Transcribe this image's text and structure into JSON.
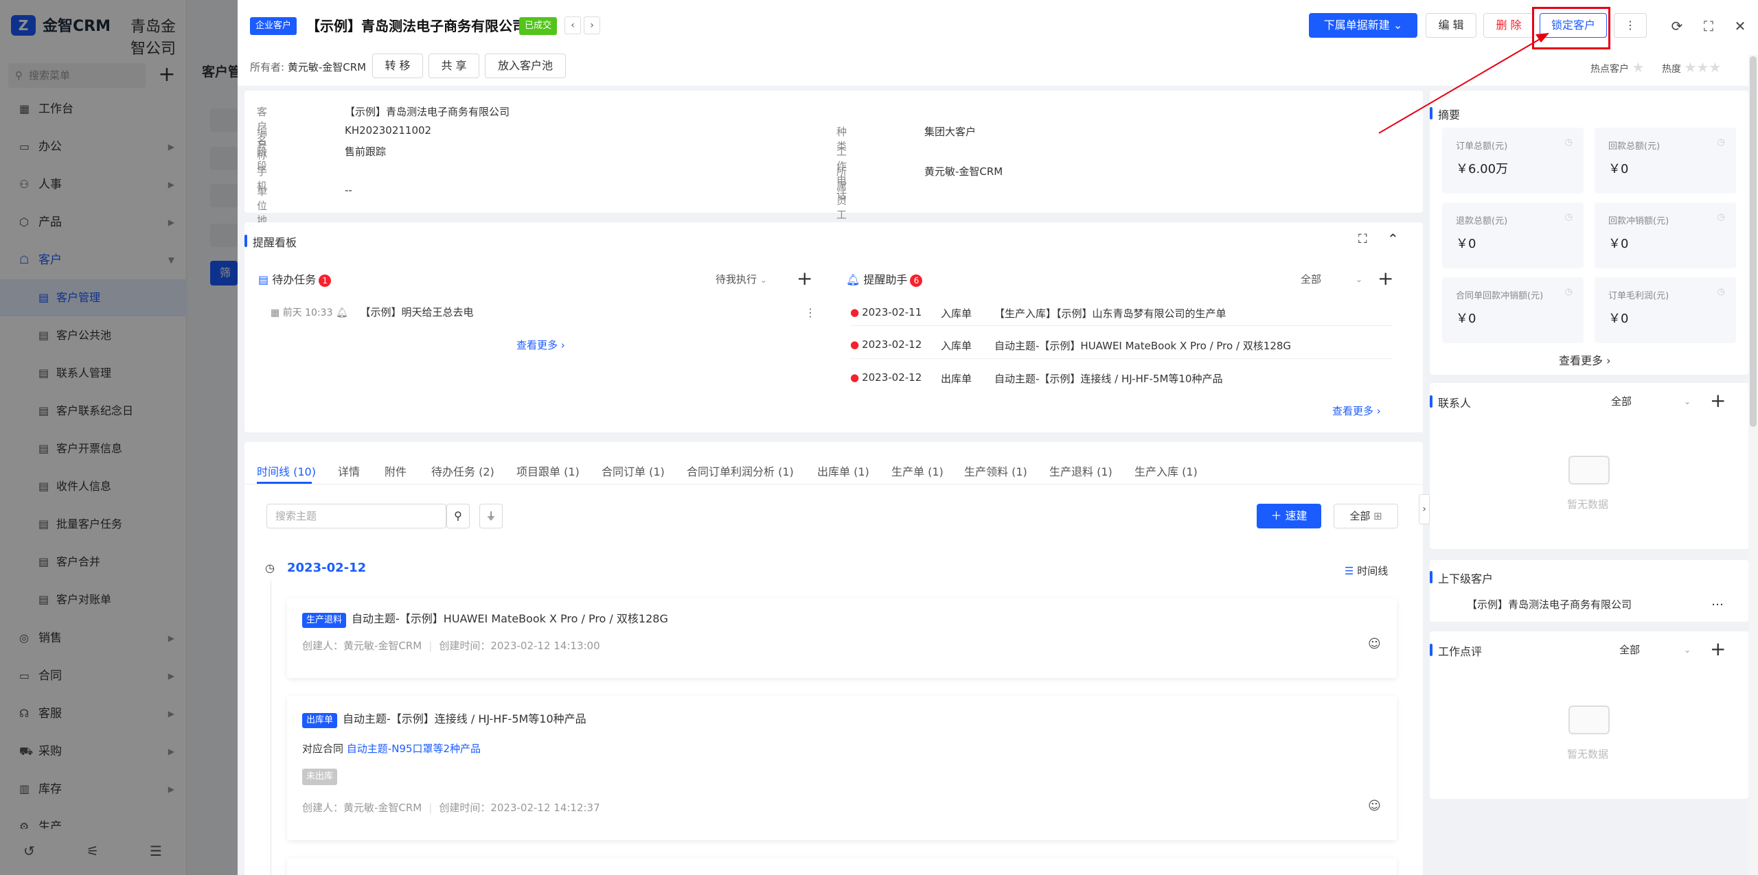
{
  "app": {
    "brand": "金智CRM",
    "company": "青岛金智公司",
    "menu_search_placeholder": "搜索菜单"
  },
  "sidebar": {
    "items": [
      {
        "label": "工作台",
        "icon": "▦"
      },
      {
        "label": "办公",
        "icon": "▭"
      },
      {
        "label": "人事",
        "icon": "⚇"
      },
      {
        "label": "产品",
        "icon": "⬡"
      },
      {
        "label": "客户",
        "icon": "☖"
      },
      {
        "label": "客户管理",
        "icon": "▤"
      },
      {
        "label": "客户公共池",
        "icon": "▤"
      },
      {
        "label": "联系人管理",
        "icon": "▤"
      },
      {
        "label": "客户联系纪念日",
        "icon": "▤"
      },
      {
        "label": "客户开票信息",
        "icon": "▤"
      },
      {
        "label": "收件人信息",
        "icon": "▤"
      },
      {
        "label": "批量客户任务",
        "icon": "▤"
      },
      {
        "label": "客户合并",
        "icon": "▤"
      },
      {
        "label": "客户对账单",
        "icon": "▤"
      },
      {
        "label": "销售",
        "icon": "◎"
      },
      {
        "label": "合同",
        "icon": "▭"
      },
      {
        "label": "客服",
        "icon": "☊"
      },
      {
        "label": "采购",
        "icon": "⛟"
      },
      {
        "label": "库存",
        "icon": "▥"
      },
      {
        "label": "生产",
        "icon": "⚙"
      }
    ],
    "footer_icons": [
      "history-icon",
      "adjust-icon",
      "menu-collapse-icon"
    ]
  },
  "bg": {
    "page_title": "客户管",
    "filter_label": "筛"
  },
  "header": {
    "type_tag": "企业客户",
    "title": "【示例】青岛测法电子商务有限公司",
    "status_tag": "已成交",
    "owner_label": "所有者:",
    "owner_value": "黄元敏-金智CRM",
    "transfer": "转 移",
    "share": "共 享",
    "to_pool": "放入客户池",
    "create_sub": "下属单据新建",
    "edit": "编 辑",
    "delete": "删 除",
    "lock": "锁定客户",
    "hot_label": "热点客户",
    "heat_label": "热度"
  },
  "info": {
    "name_k": "客户名称",
    "name_v": "【示例】青岛测法电子商务有限公司",
    "code_k": "编号",
    "code_v": "KH20230211002",
    "stage_k": "阶段",
    "stage_v": "售前跟踪",
    "phone_k": "手机",
    "phone_v": "",
    "addr_k": "单位地址",
    "addr_v": "--",
    "kind_k": "种类",
    "kind_v": "集团大客户",
    "workphone_k": "工作电话",
    "workphone_v": "",
    "staff_k": "所属员工",
    "staff_v": "黄元敏-金智CRM"
  },
  "reminder": {
    "title": "提醒看板",
    "todo_title": "待办任务",
    "todo_count": "1",
    "todo_filter": "待我执行",
    "todo_item_time": "前天 10:33",
    "todo_item_text": "【示例】明天给王总去电",
    "todo_more": "查看更多",
    "helper_title": "提醒助手",
    "helper_count": "6",
    "helper_filter": "全部",
    "helper_items": [
      {
        "date": "2023-02-11",
        "type": "入库单",
        "text": "【生产入库】【示例】山东青岛梦有限公司的生产单"
      },
      {
        "date": "2023-02-12",
        "type": "入库单",
        "text": "自动主题-【示例】HUAWEI MateBook X Pro / Pro / 双核128G"
      },
      {
        "date": "2023-02-12",
        "type": "出库单",
        "text": "自动主题-【示例】连接线 / HJ-HF-5M等10种产品"
      }
    ],
    "helper_more": "查看更多"
  },
  "tabs": [
    "时间线 (10)",
    "详情",
    "附件",
    "待办任务 (2)",
    "项目跟单 (1)",
    "合同订单 (1)",
    "合同订单利润分析 (1)",
    "出库单 (1)",
    "生产单 (1)",
    "生产领料 (1)",
    "生产退料 (1)",
    "生产入库 (1)"
  ],
  "timeline": {
    "search_placeholder": "搜索主题",
    "quick_create": "速建",
    "filter_all": "全部",
    "date": "2023-02-12",
    "view_mode": "时间线",
    "entries": [
      {
        "tag": "生产退料",
        "tag_color": "#1b5cff",
        "title": "自动主题-【示例】HUAWEI MateBook X Pro / Pro / 双核128G",
        "creator": "创建人：黄元敏-金智CRM",
        "created": "创建时间：2023-02-12 14:13:00"
      },
      {
        "tag": "出库单",
        "tag_color": "#1b5cff",
        "title": "自动主题-【示例】连接线 / HJ-HF-5M等10种产品",
        "contract_label": "对应合同",
        "contract_link": "自动主题-N95口罩等2种产品",
        "status": "未出库",
        "creator": "创建人：黄元敏-金智CRM",
        "created": "创建时间：2023-02-12 14:12:37"
      }
    ]
  },
  "summary": {
    "title": "摘要",
    "cells": [
      {
        "label": "订单总额(元)",
        "value": "￥6.00万"
      },
      {
        "label": "回款总额(元)",
        "value": "￥0"
      },
      {
        "label": "退款总额(元)",
        "value": "￥0"
      },
      {
        "label": "回款冲销额(元)",
        "value": "￥0"
      },
      {
        "label": "合同单回款冲销额(元)",
        "value": "￥0"
      },
      {
        "label": "订单毛利润(元)",
        "value": "￥0"
      }
    ],
    "more": "查看更多"
  },
  "contacts": {
    "title": "联系人",
    "filter": "全部",
    "empty": "暂无数据"
  },
  "parent": {
    "title": "上下级客户",
    "item": "【示例】青岛测法电子商务有限公司"
  },
  "review": {
    "title": "工作点评",
    "filter": "全部",
    "empty": "暂无数据"
  },
  "colors": {
    "primary": "#1b5cff",
    "danger": "#f5222d",
    "success": "#52c41a",
    "annotation": "#e60012"
  }
}
